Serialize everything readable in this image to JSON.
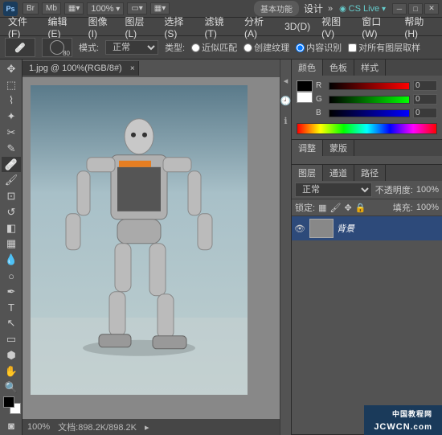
{
  "app": {
    "logo": "Ps"
  },
  "topbar": {
    "br": "Br",
    "mb": "Mb",
    "zoom": "100%",
    "mode_label": "基本功能",
    "design": "设计",
    "cslive": "CS Live"
  },
  "menu": {
    "file": "文件(F)",
    "edit": "编辑(E)",
    "image": "图像(I)",
    "layer": "图层(L)",
    "select": "选择(S)",
    "filter": "滤镜(T)",
    "analysis": "分析(A)",
    "threed": "3D(D)",
    "view": "视图(V)",
    "window": "窗口(W)",
    "help": "帮助(H)"
  },
  "options": {
    "brush_size": "80",
    "mode_label": "模式:",
    "mode_value": "正常",
    "type_label": "类型:",
    "r1": "近似匹配",
    "r2": "创建纹理",
    "r3": "内容识别",
    "sample_all": "对所有图层取样"
  },
  "document": {
    "tab_title": "1.jpg @ 100%(RGB/8#)",
    "status_zoom": "100%",
    "status_doc": "文档:898.2K/898.2K"
  },
  "panels": {
    "color_tab": "颜色",
    "swatches_tab": "色板",
    "styles_tab": "样式",
    "r_label": "R",
    "g_label": "G",
    "b_label": "B",
    "r_val": "0",
    "g_val": "0",
    "b_val": "0",
    "adjust_tab": "调整",
    "masks_tab": "蒙版",
    "layers_tab": "图层",
    "channels_tab": "通道",
    "paths_tab": "路径",
    "blend_mode": "正常",
    "opacity_label": "不透明度:",
    "opacity_val": "100%",
    "lock_label": "锁定:",
    "fill_label": "填充:",
    "fill_val": "100%",
    "layer_name": "背景"
  },
  "footer": {
    "brand": "JCWCN",
    "sub": "中国教程网"
  }
}
